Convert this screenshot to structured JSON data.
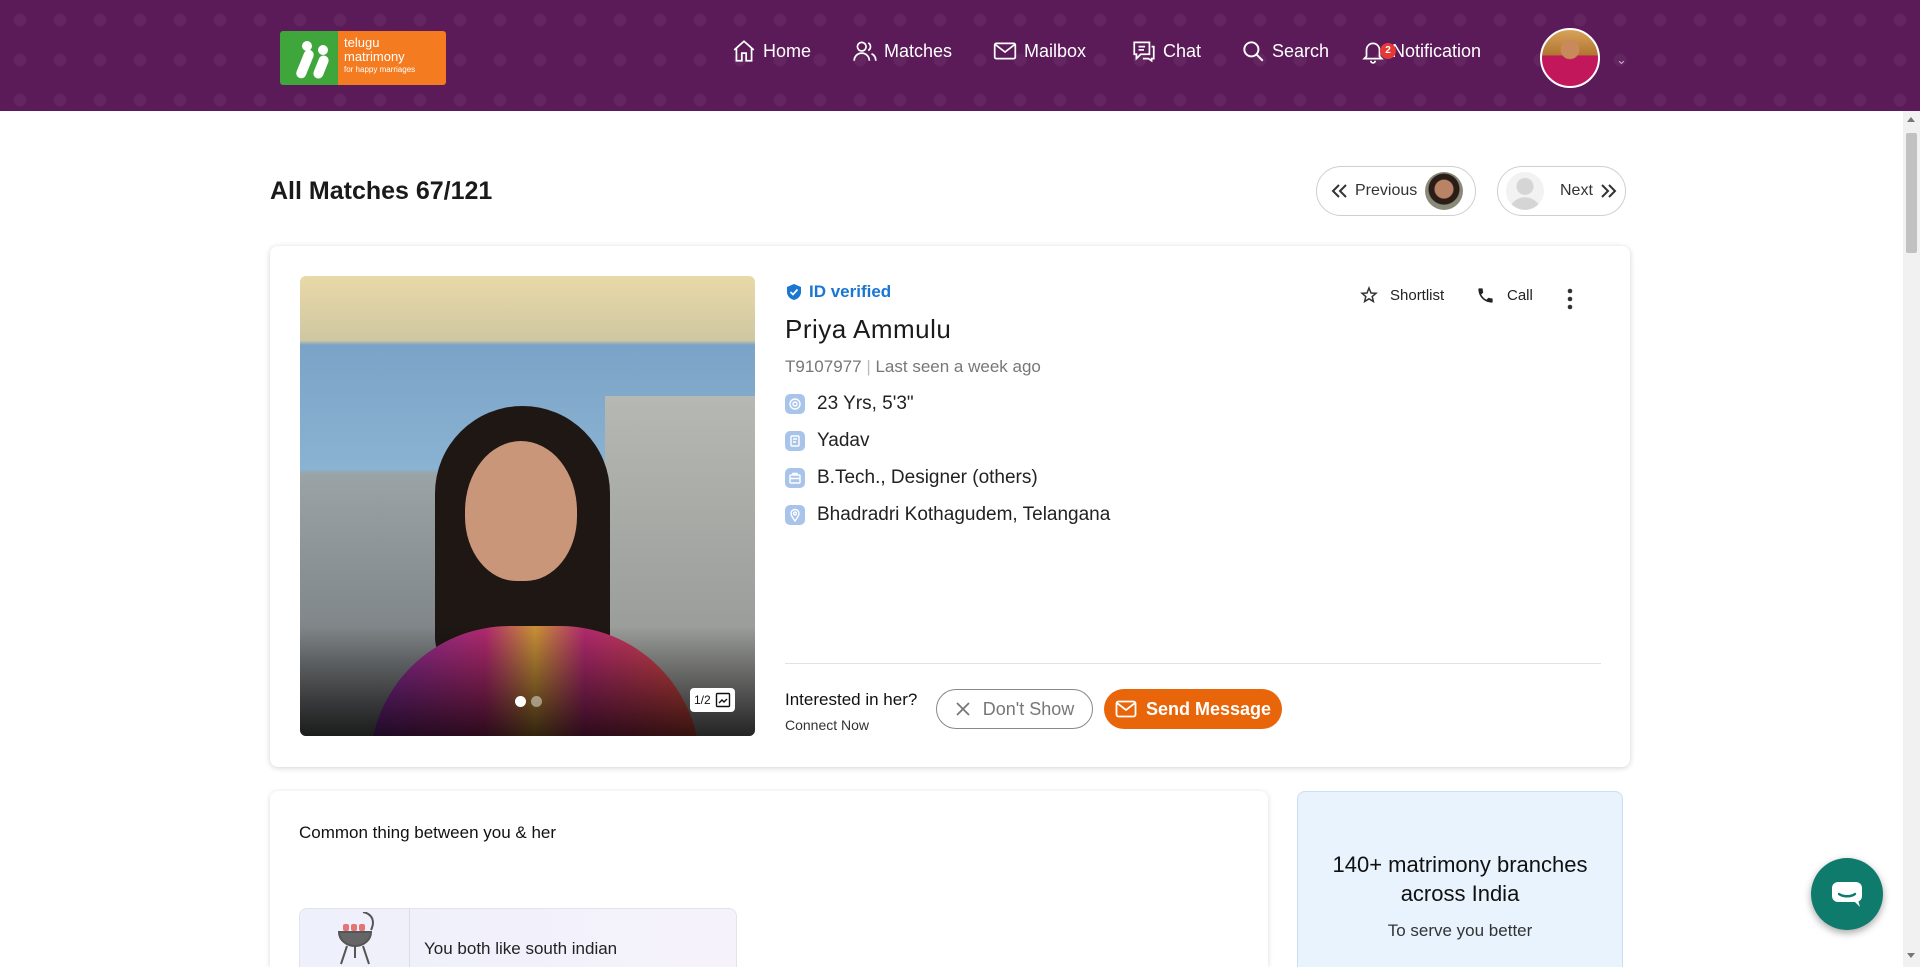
{
  "header": {
    "logo": {
      "line1": "telugu",
      "line2": "matrimony",
      "tagline": "for happy marriages"
    },
    "nav": [
      {
        "label": "Home",
        "icon": "home-icon"
      },
      {
        "label": "Matches",
        "icon": "users-icon"
      },
      {
        "label": "Mailbox",
        "icon": "mail-icon"
      },
      {
        "label": "Chat",
        "icon": "chat-icon"
      },
      {
        "label": "Search",
        "icon": "search-icon"
      },
      {
        "label": "Notification",
        "icon": "bell-icon",
        "badge": "2"
      }
    ]
  },
  "title_row": {
    "title": "All Matches 67/121",
    "previous_label": "Previous",
    "next_label": "Next"
  },
  "profile": {
    "verified_label": "ID verified",
    "name": "Priya Ammulu",
    "id": "T9107977",
    "separator": "|",
    "last_seen": "Last seen a week ago",
    "attributes": [
      {
        "icon": "age-height-icon",
        "text": "23 Yrs, 5'3\""
      },
      {
        "icon": "caste-icon",
        "text": "Yadav"
      },
      {
        "icon": "education-icon",
        "text": "B.Tech., Designer (others)"
      },
      {
        "icon": "location-icon",
        "text": "Bhadradri Kothagudem, Telangana"
      }
    ],
    "photo_counter": "1/2",
    "shortlist_label": "Shortlist",
    "call_label": "Call",
    "interest_question": "Interested in her?",
    "interest_sub": "Connect Now",
    "dont_show_label": "Don't Show",
    "send_message_label": "Send Message"
  },
  "common": {
    "title": "Common thing between you & her",
    "item_text": "You both like south indian"
  },
  "branches": {
    "title": "140+ matrimony branches across India",
    "subtitle": "To serve you better"
  },
  "colors": {
    "header_bg": "#5b1a58",
    "accent_orange": "#e8650a",
    "verified_blue": "#1976d2",
    "chat_fab": "#0f7b6c"
  }
}
